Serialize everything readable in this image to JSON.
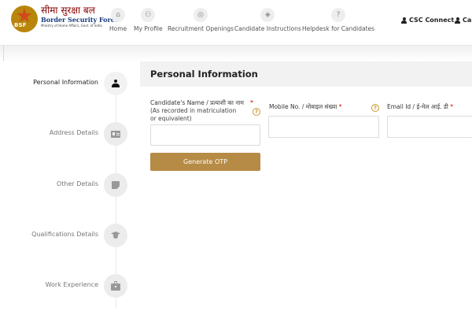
{
  "brand": {
    "hindi": "सीमा सुरक्षा बल",
    "english": "Border Security Force",
    "ministry": "Ministry of Home Affairs, Govt. of India",
    "emblem_text": "BSF",
    "colors": {
      "hindi": "#8b0000",
      "english": "#1a3b7a",
      "emblem": "#b8860b"
    }
  },
  "nav": [
    {
      "label": "Home",
      "icon": "home-icon"
    },
    {
      "label": "My Profile",
      "icon": "profile-icon"
    },
    {
      "label": "Recruitment Openings",
      "icon": "openings-icon"
    },
    {
      "label": "Candidate Instructions",
      "icon": "instructions-icon"
    },
    {
      "label": "Helpdesk for Candidates",
      "icon": "help-icon"
    }
  ],
  "top_links": [
    {
      "label": "CSC Connect",
      "icon": "person-icon"
    },
    {
      "label": "Can",
      "icon": "person-icon"
    }
  ],
  "steps": [
    {
      "label": "Personal Information",
      "icon": "person-icon",
      "active": true
    },
    {
      "label": "Address Details",
      "icon": "address-card-icon",
      "active": false
    },
    {
      "label": "Other Details",
      "icon": "note-icon",
      "active": false
    },
    {
      "label": "Qualifications Details",
      "icon": "graduation-cap-icon",
      "active": false
    },
    {
      "label": "Work Experience",
      "icon": "briefcase-icon",
      "active": false
    }
  ],
  "section": {
    "title": "Personal Information",
    "fields": {
      "name": {
        "label": "Candidate's Name / प्रत्याशी का नाम",
        "sublabel": "(As recorded in matriculation or equivalent)",
        "required": "*",
        "value": ""
      },
      "mobile": {
        "label": "Mobile No. / मोबाइल संख्या",
        "required": "*",
        "value": ""
      },
      "email": {
        "label": "Email Id / ई-मेल आई. डी",
        "required": "*",
        "value": ""
      }
    },
    "help_symbol": "?",
    "generate_otp": "Generate OTP"
  },
  "accent": "#b68b45"
}
